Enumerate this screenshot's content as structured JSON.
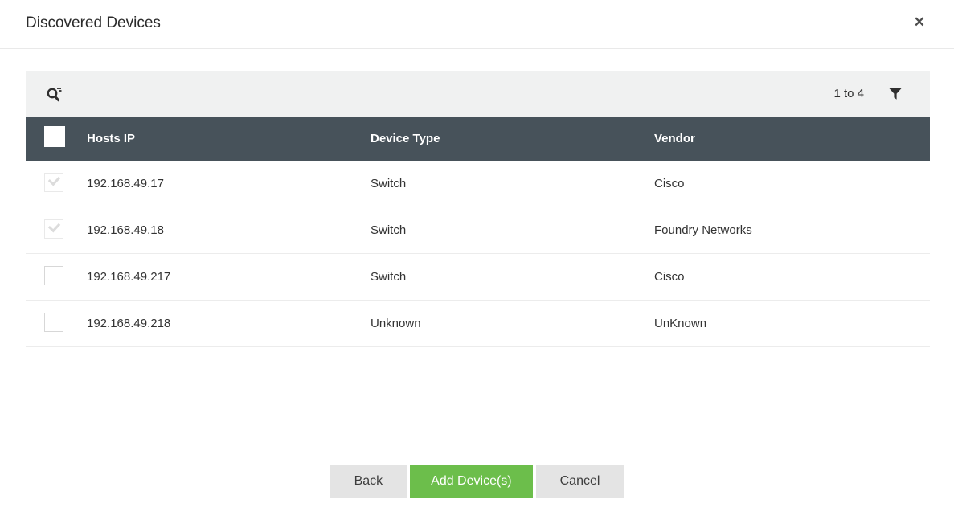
{
  "dialog": {
    "title": "Discovered Devices",
    "close_glyph": "✕"
  },
  "toolbar": {
    "range_label": "1 to 4"
  },
  "table": {
    "columns": [
      "Hosts IP",
      "Device Type",
      "Vendor"
    ],
    "rows": [
      {
        "host_ip": "192.168.49.17",
        "device_type": "Switch",
        "vendor": "Cisco",
        "checked": true,
        "disabled": true
      },
      {
        "host_ip": "192.168.49.18",
        "device_type": "Switch",
        "vendor": "Foundry Networks",
        "checked": true,
        "disabled": true
      },
      {
        "host_ip": "192.168.49.217",
        "device_type": "Switch",
        "vendor": "Cisco",
        "checked": false,
        "disabled": false
      },
      {
        "host_ip": "192.168.49.218",
        "device_type": "Unknown",
        "vendor": "UnKnown",
        "checked": false,
        "disabled": false
      }
    ]
  },
  "footer": {
    "back_label": "Back",
    "add_label": "Add Device(s)",
    "cancel_label": "Cancel"
  },
  "colors": {
    "header_bg": "#47525a",
    "toolbar_bg": "#f0f1f1",
    "accent_green": "#6cbe4b"
  }
}
